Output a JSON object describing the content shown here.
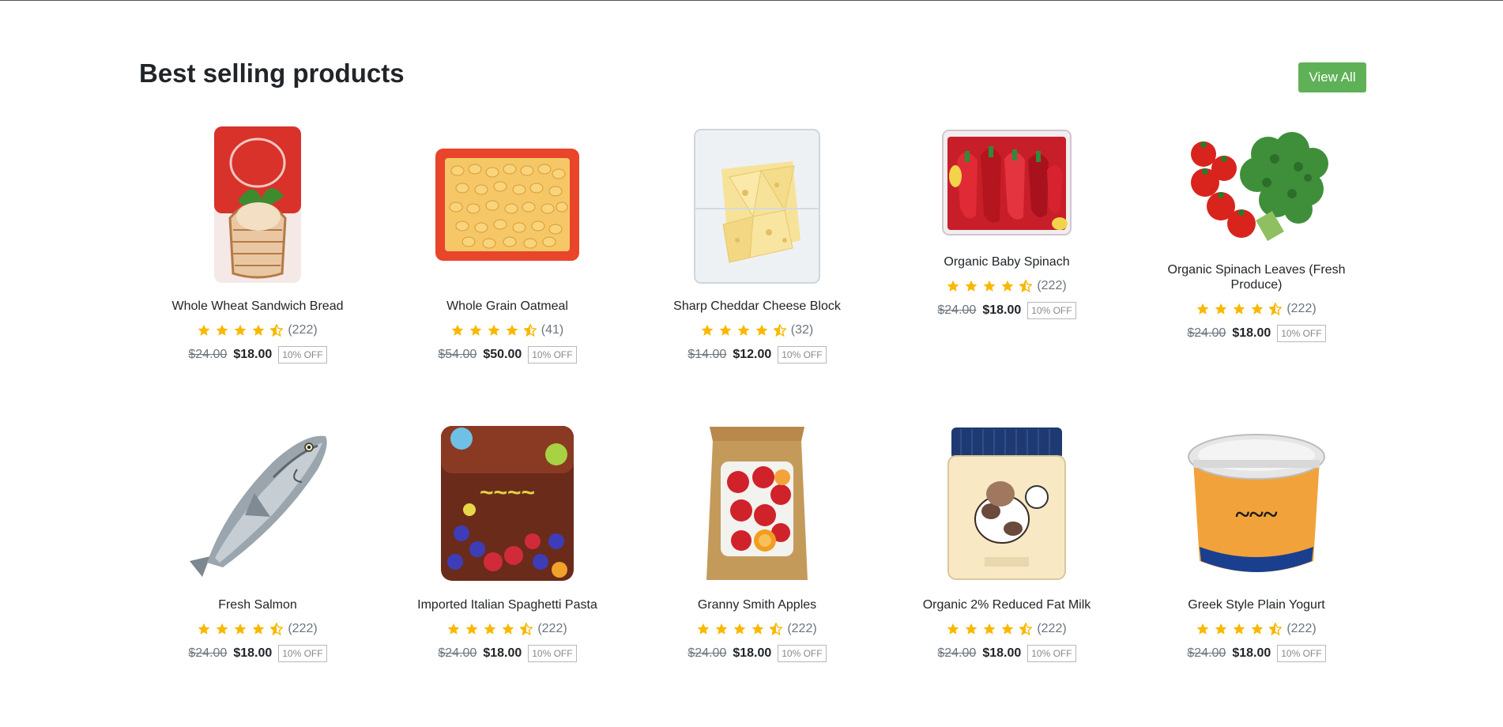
{
  "section": {
    "title": "Best selling products",
    "view_all_label": "View All"
  },
  "colors": {
    "accent": "#5fb157",
    "star": "#f9b800"
  },
  "products": [
    {
      "name": "Whole Wheat Sandwich Bread",
      "rating": 4.5,
      "reviews": "(222)",
      "old_price": "$24.00",
      "price": "$18.00",
      "discount": "10% OFF",
      "icon": "bread-bag-image"
    },
    {
      "name": "Whole Grain Oatmeal",
      "rating": 4.5,
      "reviews": "(41)",
      "old_price": "$54.00",
      "price": "$50.00",
      "discount": "10% OFF",
      "icon": "oatmeal-tray-image"
    },
    {
      "name": "Sharp Cheddar Cheese Block",
      "rating": 4.5,
      "reviews": "(32)",
      "old_price": "$14.00",
      "price": "$12.00",
      "discount": "10% OFF",
      "icon": "cheese-bag-image"
    },
    {
      "name": "Organic Baby Spinach",
      "rating": 4.5,
      "reviews": "(222)",
      "old_price": "$24.00",
      "price": "$18.00",
      "discount": "10% OFF",
      "icon": "pepper-bag-image"
    },
    {
      "name": "Organic Spinach Leaves (Fresh Produce)",
      "rating": 4.5,
      "reviews": "(222)",
      "old_price": "$24.00",
      "price": "$18.00",
      "discount": "10% OFF",
      "icon": "broccoli-tomato-image"
    },
    {
      "name": "Fresh Salmon",
      "rating": 4.5,
      "reviews": "(222)",
      "old_price": "$24.00",
      "price": "$18.00",
      "discount": "10% OFF",
      "icon": "fish-image"
    },
    {
      "name": "Imported Italian Spaghetti Pasta",
      "rating": 4.5,
      "reviews": "(222)",
      "old_price": "$24.00",
      "price": "$18.00",
      "discount": "10% OFF",
      "icon": "berry-package-image"
    },
    {
      "name": "Granny Smith Apples",
      "rating": 4.5,
      "reviews": "(222)",
      "old_price": "$24.00",
      "price": "$18.00",
      "discount": "10% OFF",
      "icon": "fruit-bag-image"
    },
    {
      "name": "Organic 2% Reduced Fat Milk",
      "rating": 4.5,
      "reviews": "(222)",
      "old_price": "$24.00",
      "price": "$18.00",
      "discount": "10% OFF",
      "icon": "milk-jar-image"
    },
    {
      "name": "Greek Style Plain Yogurt",
      "rating": 4.5,
      "reviews": "(222)",
      "old_price": "$24.00",
      "price": "$18.00",
      "discount": "10% OFF",
      "icon": "yogurt-tub-image"
    }
  ]
}
